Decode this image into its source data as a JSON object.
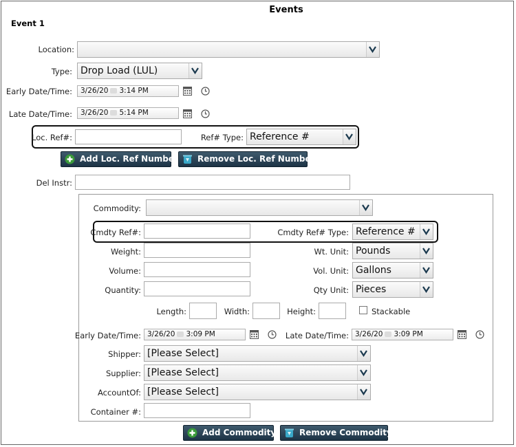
{
  "title": "Events",
  "event": {
    "heading": "Event 1",
    "location": {
      "label": "Location:",
      "value": ""
    },
    "type": {
      "label": "Type:",
      "value": "Drop Load (LUL)"
    },
    "early": {
      "label": "Early Date/Time:",
      "date": "3/26/20",
      "time": "3:14 PM"
    },
    "late": {
      "label": "Late Date/Time:",
      "date": "3/26/20",
      "time": "5:14 PM"
    },
    "loc_ref": {
      "label": "Loc. Ref#:",
      "value": "",
      "type_label": "Ref# Type:",
      "type_value": "Reference #"
    },
    "add_loc_ref": "Add Loc. Ref Number",
    "remove_loc_ref": "Remove Loc. Ref Number",
    "del_instr": {
      "label": "Del Instr:",
      "value": ""
    }
  },
  "commodity": {
    "commodity": {
      "label": "Commodity:",
      "value": ""
    },
    "cmdty_ref": {
      "label": "Cmdty Ref#:",
      "value": "",
      "type_label": "Cmdty Ref# Type:",
      "type_value": "Reference #"
    },
    "weight": {
      "label": "Weight:",
      "value": "",
      "unit_label": "Wt. Unit:",
      "unit_value": "Pounds"
    },
    "volume": {
      "label": "Volume:",
      "value": "",
      "unit_label": "Vol. Unit:",
      "unit_value": "Gallons"
    },
    "quantity": {
      "label": "Quantity:",
      "value": "",
      "unit_label": "Qty Unit:",
      "unit_value": "Pieces"
    },
    "length_label": "Length:",
    "width_label": "Width:",
    "height_label": "Height:",
    "stackable_label": "Stackable",
    "stackable_checked": false,
    "early": {
      "label": "Early Date/Time:",
      "date": "3/26/20",
      "time": "3:09 PM"
    },
    "late": {
      "label": "Late Date/Time:",
      "date": "3/26/20",
      "time": "3:09 PM"
    },
    "shipper": {
      "label": "Shipper:",
      "value": "[Please Select]"
    },
    "supplier": {
      "label": "Supplier:",
      "value": "[Please Select]"
    },
    "account_of": {
      "label": "AccountOf:",
      "value": "[Please Select]"
    },
    "container": {
      "label": "Container #:",
      "value": ""
    }
  },
  "add_commodity": "Add Commodity",
  "remove_commodity": "Remove Commodity",
  "colors": {
    "button_bg": "#2b4558",
    "add_icon": "#3a9a3a",
    "remove_icon": "#3aa8c8",
    "highlight_border": "#111111"
  }
}
